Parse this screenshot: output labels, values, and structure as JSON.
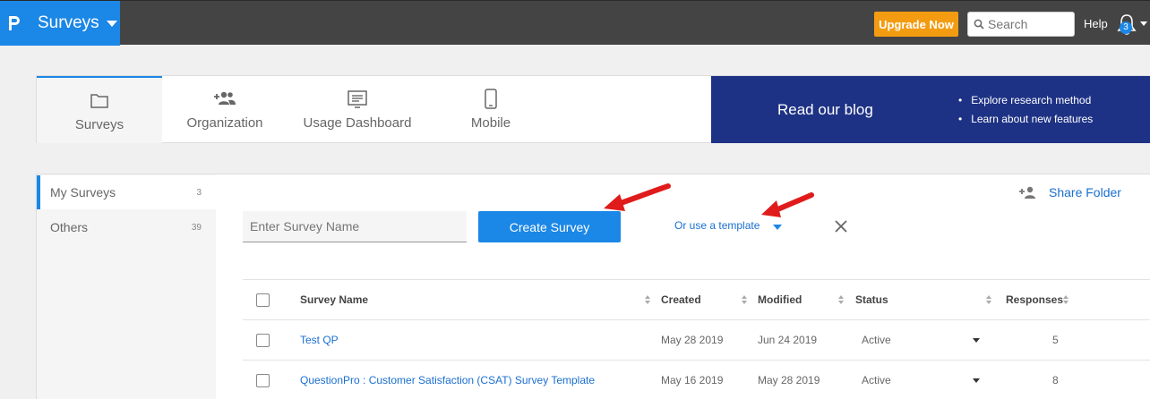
{
  "topbar": {
    "app_title": "Surveys",
    "upgrade_label": "Upgrade Now",
    "search_placeholder": "Search",
    "help_label": "Help",
    "notification_count": "3"
  },
  "nav": {
    "tabs": [
      {
        "label": "Surveys",
        "icon": "folder-icon",
        "active": true
      },
      {
        "label": "Organization",
        "icon": "add-group-icon",
        "active": false
      },
      {
        "label": "Usage Dashboard",
        "icon": "dashboard-icon",
        "active": false
      },
      {
        "label": "Mobile",
        "icon": "mobile-icon",
        "active": false
      }
    ],
    "blog": {
      "title": "Read our blog",
      "bullets": [
        "Explore research method",
        "Learn about new features"
      ]
    }
  },
  "sidebar": {
    "items": [
      {
        "label": "My Surveys",
        "count": "3"
      },
      {
        "label": "Others",
        "count": "39"
      }
    ]
  },
  "toolbar": {
    "name_placeholder": "Enter Survey Name",
    "create_label": "Create Survey",
    "template_label": "Or use a template",
    "share_label": "Share Folder"
  },
  "table": {
    "columns": [
      "Survey Name",
      "Created",
      "Modified",
      "Status",
      "Responses"
    ],
    "rows": [
      {
        "name": "Test QP",
        "created": "May 28 2019",
        "modified": "Jun 24 2019",
        "status": "Active",
        "responses": "5"
      },
      {
        "name": "QuestionPro : Customer Satisfaction (CSAT) Survey Template",
        "created": "May 16 2019",
        "modified": "May 28 2019",
        "status": "Active",
        "responses": "8"
      }
    ]
  },
  "colors": {
    "brand_blue": "#1b87e6",
    "topbar": "#444444",
    "upgrade": "#f39c12",
    "blog_bg": "#1e3285",
    "annotation_arrow": "#e01b1b"
  }
}
